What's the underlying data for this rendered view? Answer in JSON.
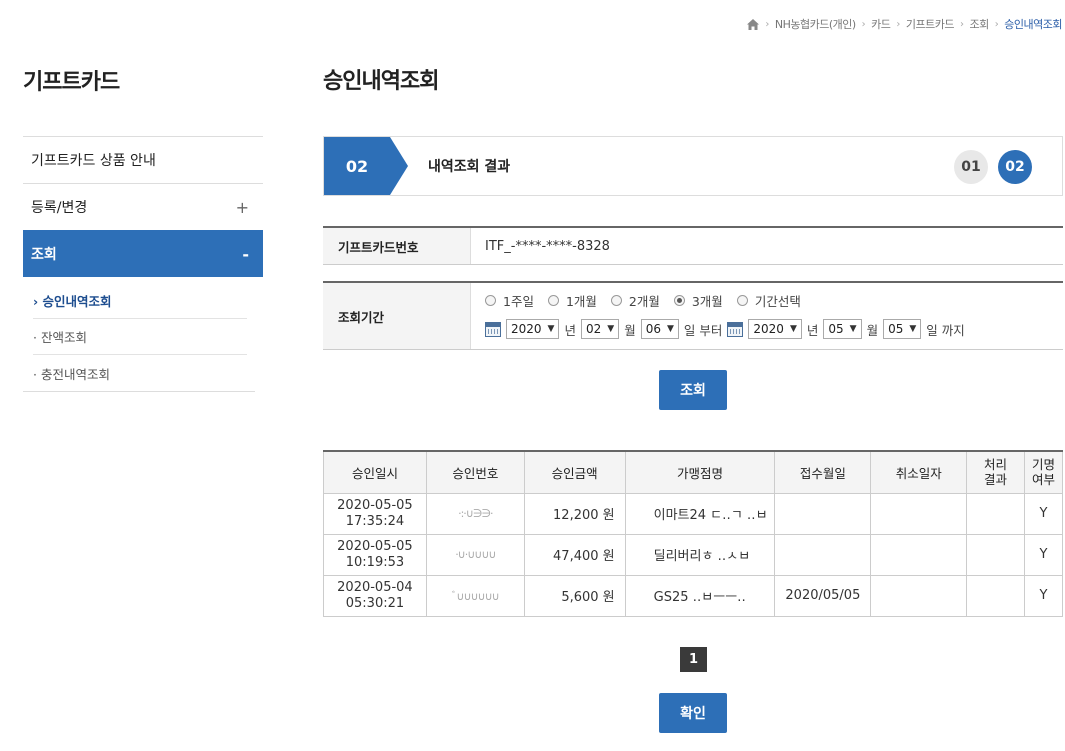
{
  "breadcrumb": {
    "items": [
      "NH농협카드(개인)",
      "카드",
      "기프트카드",
      "조회"
    ],
    "current": "승인내역조회"
  },
  "sidebar": {
    "title": "기프트카드",
    "items": [
      {
        "label": "기프트카드 상품 안내",
        "toggle": ""
      },
      {
        "label": "등록/변경",
        "toggle": "+"
      },
      {
        "label": "조회",
        "toggle": "-"
      }
    ],
    "subitems": [
      "› 승인내역조회",
      "· 잔액조회",
      "· 충전내역조회"
    ]
  },
  "page": {
    "title": "승인내역조회",
    "step_current": "02",
    "step_label": "내역조회 결과",
    "steps": [
      "01",
      "02"
    ]
  },
  "card": {
    "label": "기프트카드번호",
    "value": "ITF_-****-****-8328"
  },
  "period": {
    "label": "조회기간",
    "options": [
      "1주일",
      "1개월",
      "2개월",
      "3개월",
      "기간선택"
    ],
    "selected_index": 3,
    "from": {
      "year": "2020",
      "month": "02",
      "day": "06"
    },
    "to": {
      "year": "2020",
      "month": "05",
      "day": "05"
    },
    "unit_year": "년",
    "unit_month": "월",
    "from_suffix": "일 부터",
    "to_suffix": "일 까지"
  },
  "search_button": "조회",
  "results": {
    "headers": [
      "승인일시",
      "승인번호",
      "승인금액",
      "가맹점명",
      "접수월일",
      "취소일자",
      "처리\n결과",
      "기명\n여부"
    ],
    "rows": [
      {
        "date": "2020-05-05",
        "time": "17:35:24",
        "approval": "·:·∪∋∋·",
        "amount": "12,200 원",
        "merchant": "이마트24 ㄷ‥ㄱ ‥ㅂ",
        "received": "",
        "cancel": "",
        "result": "",
        "named": "Y"
      },
      {
        "date": "2020-05-05",
        "time": "10:19:53",
        "approval": "·∪·∪∪∪∪",
        "amount": "47,400 원",
        "merchant": "딜리버리ㅎ ‥ㅅㅂ",
        "received": "",
        "cancel": "",
        "result": "",
        "named": "Y"
      },
      {
        "date": "2020-05-04",
        "time": "05:30:21",
        "approval": "ﾞ∪∪∪∪∪∪",
        "amount": "5,600 원",
        "merchant": "GS25 ‥ㅂㅡㅡ‥",
        "received": "2020/05/05",
        "cancel": "",
        "result": "",
        "named": "Y"
      }
    ]
  },
  "pagination": {
    "current": "1"
  },
  "confirm_button": "확인"
}
